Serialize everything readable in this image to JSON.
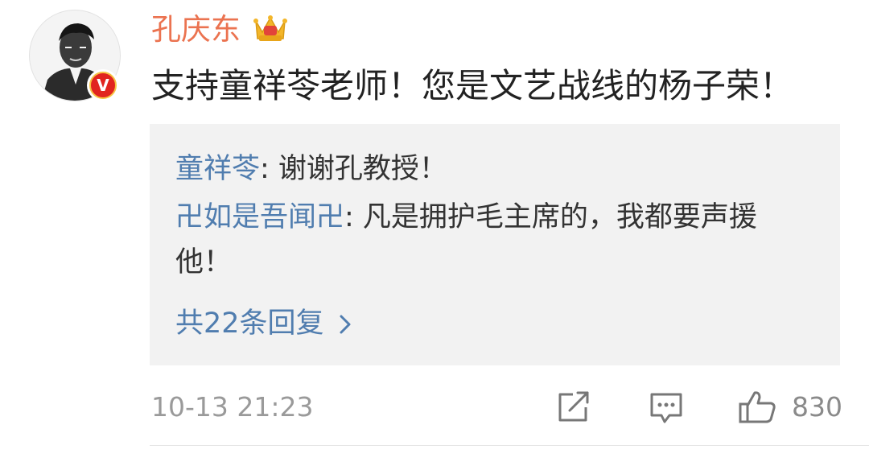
{
  "post": {
    "username": "孔庆东",
    "text": "支持童祥苓老师！您是文艺战线的杨子荣！"
  },
  "replies": [
    {
      "name": "童祥苓",
      "text": ": 谢谢孔教授！"
    },
    {
      "name": "卍如是吾闻卍",
      "text": ": 凡是拥护毛主席的，我都要声援他！"
    }
  ],
  "more_replies_label": "共22条回复",
  "footer": {
    "timestamp": "10-13 21:23",
    "like_count": "830"
  },
  "icons": {
    "verified": "verified-v-badge-icon",
    "crown": "crown-icon",
    "share": "share-icon",
    "comment": "comment-icon",
    "like": "thumbs-up-icon",
    "chevron": "chevron-right-icon"
  },
  "colors": {
    "username": "#eb7350",
    "link": "#507daf",
    "reply_bg": "#f2f2f2",
    "meta": "#9a9a9a",
    "badge": "#e1241f"
  }
}
